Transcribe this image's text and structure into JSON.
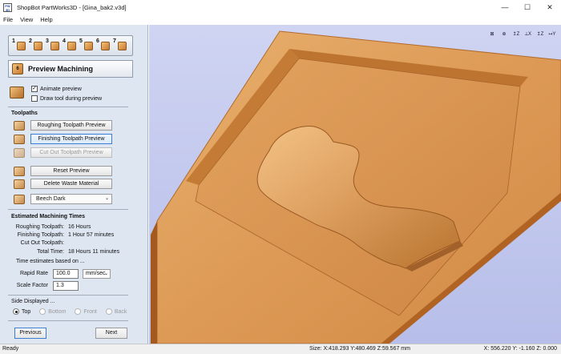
{
  "app": {
    "title": "ShopBot PartWorks3D - [Gina_bak2.v3d]",
    "icon_text": "PW 3D"
  },
  "window_controls": {
    "minimize": "—",
    "maximize": "☐",
    "close": "✕"
  },
  "menu": [
    "File",
    "View",
    "Help"
  ],
  "steps": [
    "1",
    "2",
    "3",
    "4",
    "5",
    "6",
    "7"
  ],
  "section": {
    "icon": "6",
    "title": "Preview Machining"
  },
  "options": {
    "animate_label": "Animate preview",
    "animate_checked": true,
    "draw_tool_label": "Draw tool during preview",
    "draw_tool_checked": false
  },
  "toolpaths": {
    "heading": "Toolpaths",
    "roughing_btn": "Roughing Toolpath Preview",
    "finishing_btn": "Finishing Toolpath Preview",
    "cutout_btn": "Cut Out Toolpath Preview"
  },
  "actions": {
    "reset_btn": "Reset Preview",
    "delete_btn": "Delete Waste Material",
    "material": "Beech Dark"
  },
  "times": {
    "heading": "Estimated Machining Times",
    "rows": [
      {
        "label": "Roughing Toolpath:",
        "value": "16 Hours"
      },
      {
        "label": "Finishing Toolpath:",
        "value": "1 Hour  57 minutes"
      },
      {
        "label": "Cut Out Toolpath:",
        "value": ""
      },
      {
        "label": "Total Time:",
        "value": "18 Hours  11 minutes"
      }
    ],
    "based_on": "Time estimates based on ...",
    "rapid_rate_label": "Rapid Rate",
    "rapid_rate_value": "100.0",
    "rapid_rate_unit": "mm/sec",
    "scale_factor_label": "Scale Factor",
    "scale_factor_value": "1.3"
  },
  "side": {
    "heading": "Side Displayed ...",
    "options": [
      {
        "label": "Top",
        "selected": true,
        "enabled": true
      },
      {
        "label": "Bottom",
        "selected": false,
        "enabled": false
      },
      {
        "label": "Front",
        "selected": false,
        "enabled": false
      },
      {
        "label": "Back",
        "selected": false,
        "enabled": false
      }
    ]
  },
  "nav": {
    "previous": "Previous",
    "next": "Next"
  },
  "view_tools": [
    "⊠",
    "⊕",
    "↥Z",
    "⟂X",
    "↥Z",
    "↦Y"
  ],
  "status": {
    "left": "Ready",
    "size": "Size: X:418.293 Y:480.469 Z:59.567 mm",
    "coords": "X: 556.220 Y:  -1.160 Z:   0.000"
  },
  "colors": {
    "panel_bg": "#dde6f1",
    "viewport_bg": "#c3c9ee",
    "wood_light": "#e7a866",
    "wood_dark": "#b3692b"
  }
}
